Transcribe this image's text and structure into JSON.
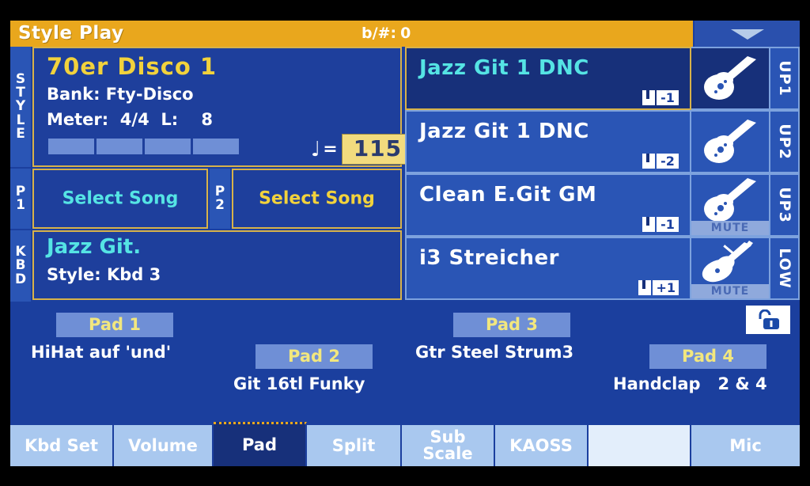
{
  "header": {
    "title": "Style Play",
    "keysig_label": "b/#:",
    "keysig_value": "0",
    "menu_icon": "chevron-down-icon"
  },
  "style": {
    "tag": "STYLE",
    "name": "70er Disco 1",
    "bank": "Bank: Fty-Disco",
    "meter": "Meter:  4/4  L:    8",
    "tempo_note": "♩",
    "tempo_eq": "=",
    "tempo": "115",
    "beats": 4
  },
  "pad_tracks": {
    "p1_tag": "P1",
    "p1_label": "Select Song",
    "p2_tag": "P2",
    "p2_label": "Select Song"
  },
  "keyboard": {
    "tag": "KBD",
    "name": "Jazz Git.",
    "style": "Style: Kbd 3"
  },
  "slots": [
    {
      "tag": "UP1",
      "name": "Jazz Git 1 DNC",
      "octave": "-1",
      "icon": "guitar-icon",
      "selected": true,
      "muted": false,
      "mute_label": ""
    },
    {
      "tag": "UP2",
      "name": "Jazz Git 1 DNC",
      "octave": "-2",
      "icon": "guitar-icon",
      "selected": false,
      "muted": false,
      "mute_label": ""
    },
    {
      "tag": "UP3",
      "name": "Clean E.Git GM",
      "octave": "-1",
      "icon": "guitar-icon",
      "selected": false,
      "muted": true,
      "mute_label": "MUTE"
    },
    {
      "tag": "LOW",
      "name": "i3 Streicher",
      "octave": "+1",
      "icon": "violin-icon",
      "selected": false,
      "muted": true,
      "mute_label": "MUTE"
    }
  ],
  "pads": [
    {
      "label": "Pad 1",
      "name": "HiHat auf 'und'"
    },
    {
      "label": "Pad 2",
      "name": "Git 16tl Funky"
    },
    {
      "label": "Pad 3",
      "name": "Gtr Steel Strum3"
    },
    {
      "label": "Pad 4",
      "name": "Handclap   2 & 4"
    }
  ],
  "lock_icon": "padlock-open-icon",
  "tabs": [
    {
      "label": "Kbd Set",
      "active": false,
      "blank": false
    },
    {
      "label": "Volume",
      "active": false,
      "blank": false
    },
    {
      "label": "Pad",
      "active": true,
      "blank": false
    },
    {
      "label": "Split",
      "active": false,
      "blank": false
    },
    {
      "label": "Sub\nScale",
      "active": false,
      "blank": false
    },
    {
      "label": "KAOSS",
      "active": false,
      "blank": false
    },
    {
      "label": "",
      "active": false,
      "blank": true
    },
    {
      "label": "Mic",
      "active": false,
      "blank": false
    }
  ],
  "colors": {
    "header_bg": "#e9a71d",
    "screen_bg": "#1b3f9e",
    "accent_yellow": "#f2d23c",
    "accent_cyan": "#55e4e4",
    "tab_bg": "#a9c8ef",
    "selected_bg": "#17307a"
  }
}
